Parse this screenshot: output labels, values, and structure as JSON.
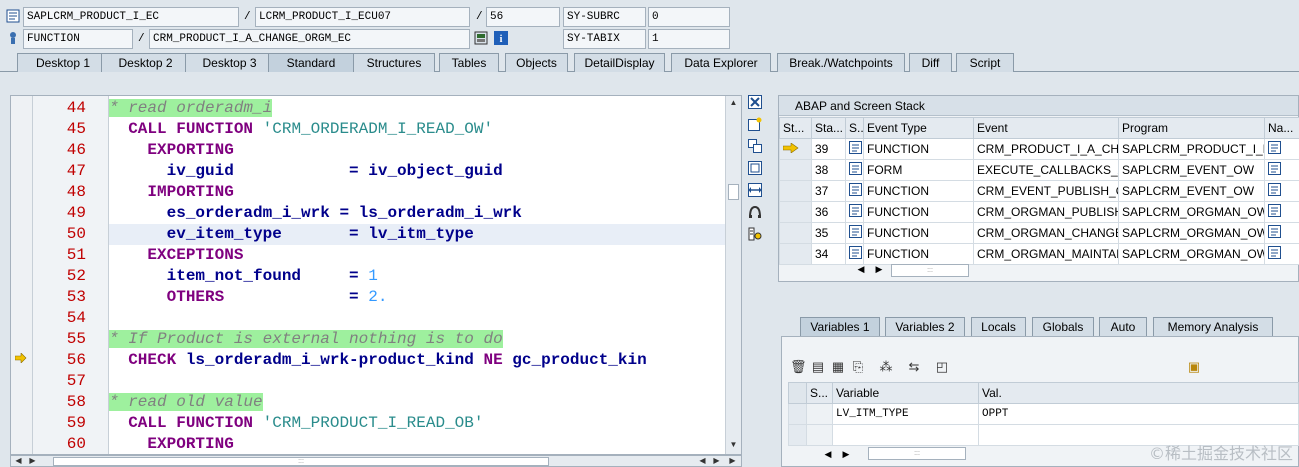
{
  "header": {
    "program": "SAPLCRM_PRODUCT_I_EC",
    "include": "LCRM_PRODUCT_I_ECU07",
    "line": "56",
    "sy_subrc_label": "SY-SUBRC",
    "sy_subrc_value": "0",
    "event_type": "FUNCTION",
    "event": "CRM_PRODUCT_I_A_CHANGE_ORGM_EC",
    "sy_tabix_label": "SY-TABIX",
    "sy_tabix_value": "1",
    "sep1": "/",
    "sep2": "/",
    "sep3": "/"
  },
  "tabs": [
    "Desktop 1",
    "Desktop 2",
    "Desktop 3",
    "Standard",
    "Structures",
    "Tables",
    "Objects",
    "DetailDisplay",
    "Data Explorer",
    "Break./Watchpoints",
    "Diff",
    "Script"
  ],
  "active_tab": "Standard",
  "code": {
    "lines": [
      {
        "no": "44",
        "text": "* read orderadm_i"
      },
      {
        "no": "45",
        "text": "  CALL FUNCTION 'CRM_ORDERADM_I_READ_OW'"
      },
      {
        "no": "46",
        "text": "    EXPORTING"
      },
      {
        "no": "47",
        "text": "      iv_guid            = iv_object_guid"
      },
      {
        "no": "48",
        "text": "    IMPORTING"
      },
      {
        "no": "49",
        "text": "      es_orderadm_i_wrk = ls_orderadm_i_wrk"
      },
      {
        "no": "50",
        "text": "      ev_item_type       = lv_itm_type"
      },
      {
        "no": "51",
        "text": "    EXCEPTIONS"
      },
      {
        "no": "52",
        "text": "      item_not_found     = 1"
      },
      {
        "no": "53",
        "text": "      OTHERS             = 2."
      },
      {
        "no": "54",
        "text": ""
      },
      {
        "no": "55",
        "text": "* If Product is external nothing is to do"
      },
      {
        "no": "56",
        "text": "  CHECK ls_orderadm_i_wrk-product_kind NE gc_product_kin"
      },
      {
        "no": "57",
        "text": ""
      },
      {
        "no": "58",
        "text": "* read old value"
      },
      {
        "no": "59",
        "text": "  CALL FUNCTION 'CRM_PRODUCT_I_READ_OB'"
      },
      {
        "no": "60",
        "text": "    EXPORTING"
      }
    ]
  },
  "stack": {
    "title": "ABAP and Screen Stack",
    "columns": [
      "St...",
      "Sta...",
      "S...",
      "Event Type",
      "Event",
      "Program",
      "Na..."
    ],
    "rows": [
      {
        "level": "39",
        "event_type": "FUNCTION",
        "event": "CRM_PRODUCT_I_A_CH...",
        "program": "SAPLCRM_PRODUCT_I_EC"
      },
      {
        "level": "38",
        "event_type": "FORM",
        "event": "EXECUTE_CALLBACKS_A...",
        "program": "SAPLCRM_EVENT_OW"
      },
      {
        "level": "37",
        "event_type": "FUNCTION",
        "event": "CRM_EVENT_PUBLISH_O...",
        "program": "SAPLCRM_EVENT_OW"
      },
      {
        "level": "36",
        "event_type": "FUNCTION",
        "event": "CRM_ORGMAN_PUBLISH...",
        "program": "SAPLCRM_ORGMAN_OW"
      },
      {
        "level": "35",
        "event_type": "FUNCTION",
        "event": "CRM_ORGMAN_CHANGE...",
        "program": "SAPLCRM_ORGMAN_OW"
      },
      {
        "level": "34",
        "event_type": "FUNCTION",
        "event": "CRM_ORGMAN_MAINTAI...",
        "program": "SAPLCRM_ORGMAN_OW"
      }
    ]
  },
  "var_tabs": [
    "Variables 1",
    "Variables 2",
    "Locals",
    "Globals",
    "Auto",
    "Memory Analysis"
  ],
  "var_active_tab": "Variables 1",
  "variables": {
    "columns": [
      "S...",
      "Variable",
      "Val."
    ],
    "rows": [
      {
        "variable": "LV_ITM_TYPE",
        "value": "OPPT"
      }
    ]
  },
  "watermark": "©稀土掘金技术社区",
  "icons": {
    "program": "program-icon",
    "event": "event-icon",
    "stack_pointer": "arrow-right-icon",
    "breakpoint_marker": "arrow-right-icon"
  }
}
